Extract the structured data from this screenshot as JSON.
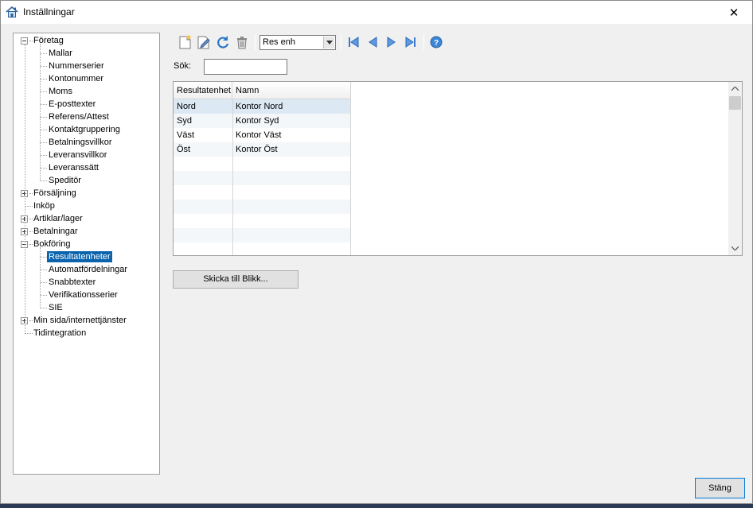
{
  "window": {
    "title": "Inställningar",
    "icon": "house-icon",
    "close_glyph": "✕"
  },
  "tree": {
    "groups": [
      {
        "label": "Företag",
        "expanded": true,
        "children": [
          "Mallar",
          "Nummerserier",
          "Kontonummer",
          "Moms",
          "E-posttexter",
          "Referens/Attest",
          "Kontaktgruppering",
          "Betalningsvillkor",
          "Leveransvillkor",
          "Leveranssätt",
          "Speditör"
        ]
      },
      {
        "label": "Försäljning",
        "expanded": false,
        "children": []
      },
      {
        "label": "Inköp",
        "leaf": true
      },
      {
        "label": "Artiklar/lager",
        "expanded": false,
        "children": []
      },
      {
        "label": "Betalningar",
        "expanded": false,
        "children": []
      },
      {
        "label": "Bokföring",
        "expanded": true,
        "children": [
          "Resultatenheter",
          "Automatfördelningar",
          "Snabbtexter",
          "Verifikationsserier",
          "SIE"
        ]
      },
      {
        "label": "Min sida/internettjänster",
        "expanded": false,
        "children": []
      },
      {
        "label": "Tidintegration",
        "leaf": true
      }
    ],
    "selected": "Resultatenheter"
  },
  "toolbar": {
    "buttons": [
      "new-icon",
      "edit-icon",
      "refresh-icon",
      "delete-icon"
    ],
    "select_value": "Res enh",
    "nav_buttons": [
      "first-record-icon",
      "previous-record-icon",
      "next-record-icon",
      "last-record-icon"
    ],
    "help": "help-icon"
  },
  "search": {
    "label": "Sök:",
    "value": ""
  },
  "grid": {
    "columns": [
      "Resultatenhet",
      "Namn"
    ],
    "rows": [
      [
        "Nord",
        "Kontor Nord"
      ],
      [
        "Syd",
        "Kontor Syd"
      ],
      [
        "Väst",
        "Kontor Väst"
      ],
      [
        "Öst",
        "Kontor Öst"
      ]
    ]
  },
  "buttons": {
    "send": "Skicka till Blikk...",
    "close": "Stäng"
  },
  "colors": {
    "selection": "#0a64ad",
    "row_highlight": "#dce9f5",
    "stripe": "#f4f7fa"
  }
}
